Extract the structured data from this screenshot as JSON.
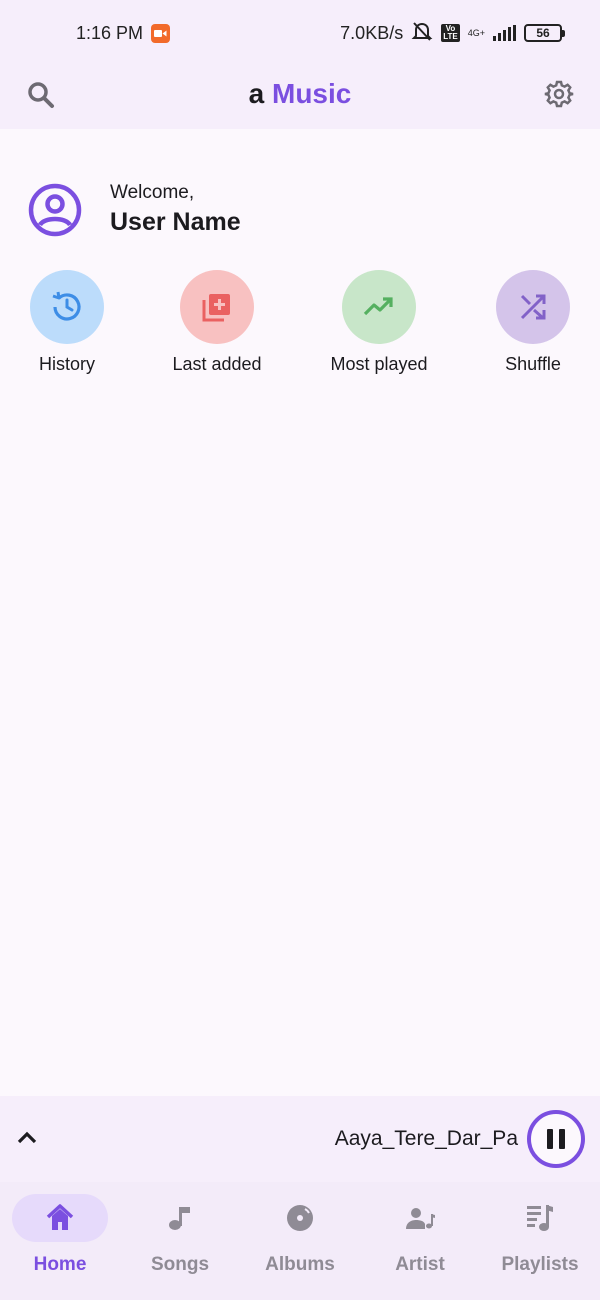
{
  "status_bar": {
    "time": "1:16 PM",
    "net_speed": "7.0KB/s",
    "volte": "Vo\nLTE",
    "network": "4G+",
    "battery": "56"
  },
  "app_bar": {
    "title_prefix": "a",
    "title_main": "Music",
    "accent_color": "#7b4fe0"
  },
  "welcome": {
    "greeting": "Welcome,",
    "user_name": "User Name"
  },
  "quick_actions": [
    {
      "label": "History",
      "icon": "history-icon",
      "color": "#bcdcfb",
      "icon_color": "#3d8de6"
    },
    {
      "label": "Last added",
      "icon": "library-add-icon",
      "color": "#f8c1c1",
      "icon_color": "#ea6161"
    },
    {
      "label": "Most played",
      "icon": "trending-up-icon",
      "color": "#c8e6c9",
      "icon_color": "#55b060"
    },
    {
      "label": "Shuffle",
      "icon": "shuffle-icon",
      "color": "#d4c4ea",
      "icon_color": "#8262c8"
    }
  ],
  "mini_player": {
    "song_title": "Aaya_Tere_Dar_Pa"
  },
  "bottom_nav": [
    {
      "label": "Home",
      "icon": "home-icon",
      "active": true
    },
    {
      "label": "Songs",
      "icon": "music-note-icon",
      "active": false
    },
    {
      "label": "Albums",
      "icon": "album-icon",
      "active": false
    },
    {
      "label": "Artist",
      "icon": "artist-icon",
      "active": false
    },
    {
      "label": "Playlists",
      "icon": "playlist-icon",
      "active": false
    }
  ]
}
